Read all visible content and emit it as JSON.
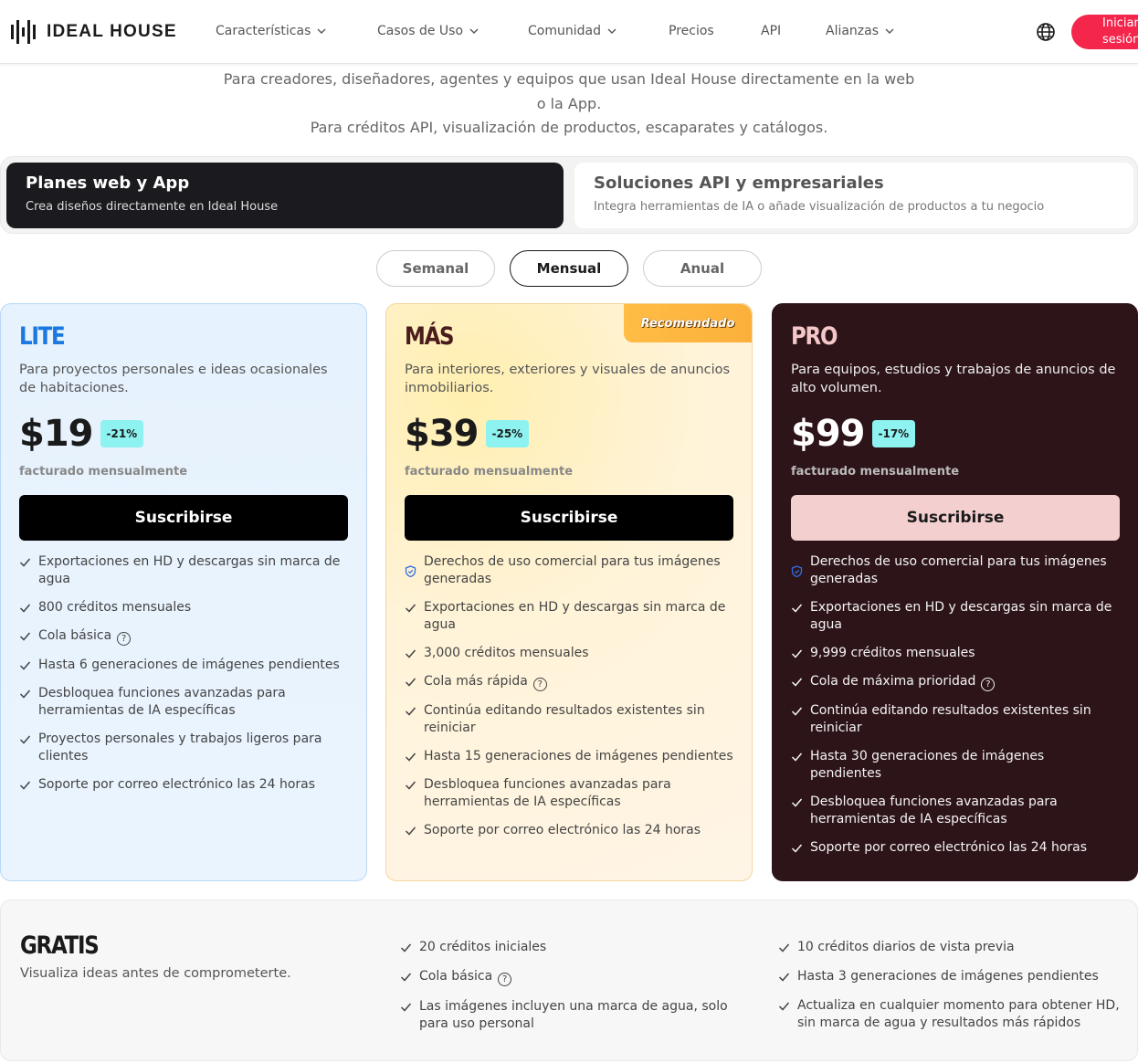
{
  "header": {
    "brand": "IDEAL HOUSE",
    "nav": [
      {
        "label": "Características",
        "has_menu": true
      },
      {
        "label": "Casos de Uso",
        "has_menu": true
      },
      {
        "label": "Comunidad",
        "has_menu": true
      },
      {
        "label": "Precios",
        "has_menu": false
      },
      {
        "label": "API",
        "has_menu": false
      },
      {
        "label": "Alianzas",
        "has_menu": true
      }
    ],
    "language_icon": "globe-icon",
    "login_line1": "Iniciar",
    "login_line2": "sesión",
    "login_color": "#f5264b"
  },
  "intro": {
    "line1": "Para creadores, diseñadores, agentes y equipos que usan Ideal House directamente en la web",
    "line2": "o la App.",
    "line3": "Para créditos API, visualización de productos, escaparates y catálogos."
  },
  "segments": [
    {
      "title": "Planes web y App",
      "subtitle": "Crea diseños directamente en Ideal House",
      "active": true
    },
    {
      "title": "Soluciones API y empresariales",
      "subtitle": "Integra herramientas de IA o añade visualización de productos a tu negocio",
      "active": false
    }
  ],
  "billing": {
    "options": [
      "Semanal",
      "Mensual",
      "Anual"
    ],
    "selected": "Mensual"
  },
  "plans": [
    {
      "name": "LITE",
      "description": "Para proyectos personales e ideas ocasionales de habitaciones.",
      "price": "$19",
      "discount": "-21%",
      "billed": "facturado mensualmente",
      "cta": "Suscribirse",
      "accent": "#1a78e0",
      "features": [
        {
          "text": "Exportaciones en HD y descargas sin marca de agua",
          "icon": "check-icon"
        },
        {
          "text": "800 créditos mensuales",
          "icon": "check-icon"
        },
        {
          "text": "Cola básica",
          "icon": "check-icon",
          "help": "?"
        },
        {
          "text": "Hasta 6 generaciones de imágenes pendientes",
          "icon": "check-icon"
        },
        {
          "text": "Desbloquea funciones avanzadas para herramientas de IA específicas",
          "icon": "check-icon"
        },
        {
          "text": "Proyectos personales y trabajos ligeros para clientes",
          "icon": "check-icon"
        },
        {
          "text": "Soporte por correo electrónico las 24 horas",
          "icon": "check-icon"
        }
      ]
    },
    {
      "name": "MÁS",
      "badge": "Recomendado",
      "description": "Para interiores, exteriores y visuales de anuncios inmobiliarios.",
      "price": "$39",
      "discount": "-25%",
      "billed": "facturado mensualmente",
      "cta": "Suscribirse",
      "accent": "#fbb03b",
      "features": [
        {
          "text": "Derechos de uso comercial para tus imágenes generadas",
          "icon": "shield-icon"
        },
        {
          "text": "Exportaciones en HD y descargas sin marca de agua",
          "icon": "check-icon"
        },
        {
          "text": "3,000 créditos mensuales",
          "icon": "check-icon"
        },
        {
          "text": "Cola más rápida",
          "icon": "check-icon",
          "help": "?"
        },
        {
          "text": "Continúa editando resultados existentes sin reiniciar",
          "icon": "check-icon"
        },
        {
          "text": "Hasta 15 generaciones de imágenes pendientes",
          "icon": "check-icon"
        },
        {
          "text": "Desbloquea funciones avanzadas para herramientas de IA específicas",
          "icon": "check-icon"
        },
        {
          "text": "Soporte por correo electrónico las 24 horas",
          "icon": "check-icon"
        }
      ]
    },
    {
      "name": "PRO",
      "description": "Para equipos, estudios y trabajos de anuncios de alto volumen.",
      "price": "$99",
      "discount": "-17%",
      "billed": "facturado mensualmente",
      "cta": "Suscribirse",
      "accent": "#2d1419",
      "features": [
        {
          "text": "Derechos de uso comercial para tus imágenes generadas",
          "icon": "shield-icon"
        },
        {
          "text": "Exportaciones en HD y descargas sin marca de agua",
          "icon": "check-icon"
        },
        {
          "text": "9,999 créditos mensuales",
          "icon": "check-icon"
        },
        {
          "text": "Cola de máxima prioridad",
          "icon": "check-icon",
          "help": "?"
        },
        {
          "text": "Continúa editando resultados existentes sin reiniciar",
          "icon": "check-icon"
        },
        {
          "text": "Hasta 30 generaciones de imágenes pendientes",
          "icon": "check-icon"
        },
        {
          "text": "Desbloquea funciones avanzadas para herramientas de IA específicas",
          "icon": "check-icon"
        },
        {
          "text": "Soporte por correo electrónico las 24 horas",
          "icon": "check-icon"
        }
      ]
    }
  ],
  "free": {
    "name": "GRATIS",
    "description": "Visualiza ideas antes de comprometerte.",
    "col1": [
      {
        "text": "20 créditos iniciales",
        "icon": "check-icon"
      },
      {
        "text": "Cola básica",
        "icon": "check-icon",
        "help": "?"
      },
      {
        "text": "Las imágenes incluyen una marca de agua, solo para uso personal",
        "icon": "check-icon"
      }
    ],
    "col2": [
      {
        "text": "10 créditos diarios de vista previa",
        "icon": "check-icon"
      },
      {
        "text": "Hasta 3 generaciones de imágenes pendientes",
        "icon": "check-icon"
      },
      {
        "text": "Actualiza en cualquier momento para obtener HD, sin marca de agua y resultados más rápidos",
        "icon": "check-icon"
      }
    ]
  }
}
